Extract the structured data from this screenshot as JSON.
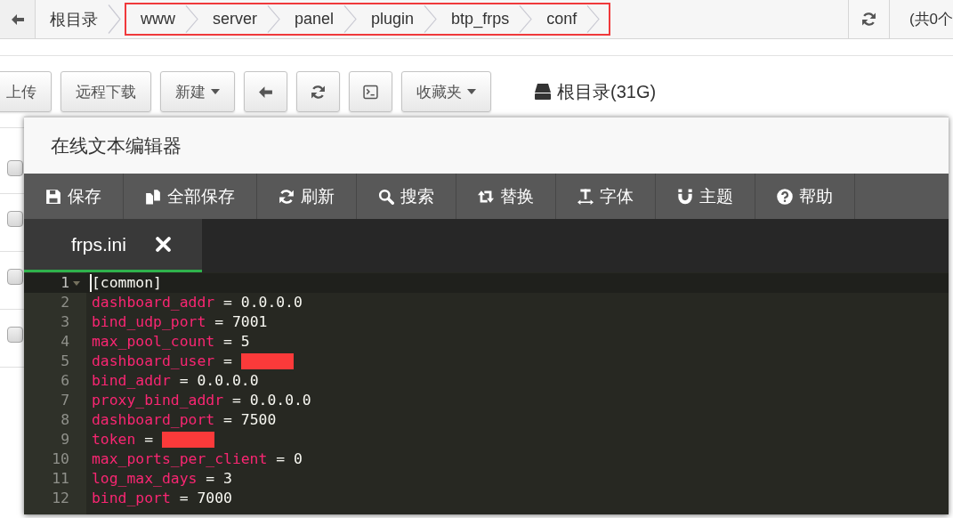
{
  "path_bar": {
    "crumbs": [
      {
        "label": "根目录",
        "highlighted": false
      },
      {
        "label": "www",
        "highlighted": true
      },
      {
        "label": "server",
        "highlighted": true
      },
      {
        "label": "panel",
        "highlighted": true
      },
      {
        "label": "plugin",
        "highlighted": true
      },
      {
        "label": "btp_frps",
        "highlighted": true
      },
      {
        "label": "conf",
        "highlighted": true
      }
    ],
    "summary": "(共0个"
  },
  "toolbar": {
    "buttons": [
      {
        "kind": "text",
        "label": "上传"
      },
      {
        "kind": "text",
        "label": "远程下载"
      },
      {
        "kind": "dropdown",
        "label": "新建"
      },
      {
        "kind": "back"
      },
      {
        "kind": "refresh"
      },
      {
        "kind": "terminal"
      },
      {
        "kind": "dropdown",
        "label": "收藏夹"
      }
    ],
    "disk": "根目录(31G)"
  },
  "file_list": {
    "rows": [
      {
        "checked": false
      },
      {
        "checked": false
      },
      {
        "checked": false
      },
      {
        "checked": false
      }
    ]
  },
  "editor": {
    "title": "在线文本编辑器",
    "actions": [
      {
        "kind": "save",
        "label": "保存"
      },
      {
        "kind": "save_all",
        "label": "全部保存"
      },
      {
        "kind": "refresh",
        "label": "刷新"
      },
      {
        "kind": "search",
        "label": "搜索"
      },
      {
        "kind": "replace",
        "label": "替换"
      },
      {
        "kind": "font",
        "label": "字体"
      },
      {
        "kind": "theme",
        "label": "主题"
      },
      {
        "kind": "help",
        "label": "帮助"
      }
    ],
    "tabs": [
      {
        "label": "frps.ini",
        "selected": true
      }
    ],
    "lines": [
      {
        "number": "1",
        "kind": "section",
        "text": "[common]",
        "active": true
      },
      {
        "number": "2",
        "kind": "pair",
        "key": "dashboard_addr",
        "op": "=",
        "value": "0.0.0.0",
        "active": false
      },
      {
        "number": "3",
        "kind": "pair",
        "key": "bind_udp_port",
        "op": "=",
        "value": "7001",
        "active": false
      },
      {
        "number": "4",
        "kind": "pair",
        "key": "max_pool_count",
        "op": "=",
        "value": "5",
        "active": false
      },
      {
        "number": "5",
        "kind": "redacted",
        "key": "dashboard_user",
        "op": "=",
        "active": false
      },
      {
        "number": "6",
        "kind": "pair",
        "key": "bind_addr",
        "op": "=",
        "value": "0.0.0.0",
        "active": false
      },
      {
        "number": "7",
        "kind": "pair",
        "key": "proxy_bind_addr",
        "op": "=",
        "value": "0.0.0.0",
        "active": false
      },
      {
        "number": "8",
        "kind": "pair",
        "key": "dashboard_port",
        "op": "=",
        "value": "7500",
        "active": false
      },
      {
        "number": "9",
        "kind": "redacted",
        "key": "token",
        "op": "=",
        "active": false
      },
      {
        "number": "10",
        "kind": "pair",
        "key": "max_ports_per_client",
        "op": "=",
        "value": "0",
        "active": false
      },
      {
        "number": "11",
        "kind": "pair",
        "key": "log_max_days",
        "op": "=",
        "value": "3",
        "active": false
      },
      {
        "number": "12",
        "kind": "pair",
        "key": "bind_port",
        "op": "=",
        "value": "7000",
        "active": false
      }
    ]
  }
}
